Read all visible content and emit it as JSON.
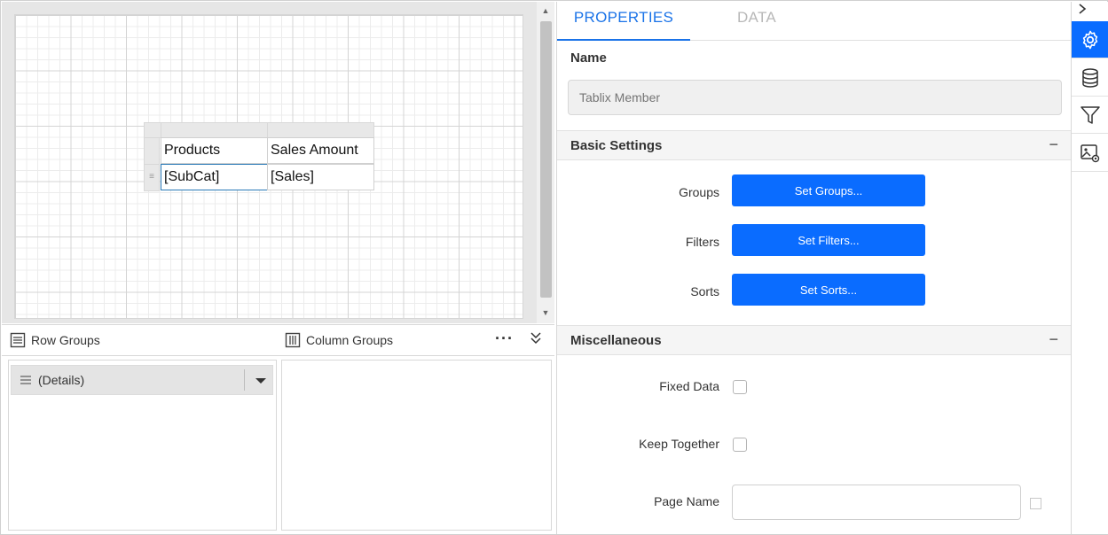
{
  "designer": {
    "tablix": {
      "header_row": [
        "Products",
        "Sales Amount"
      ],
      "detail_row": [
        "[SubCat]",
        "[Sales]"
      ]
    }
  },
  "groups": {
    "row_groups_title": "Row Groups",
    "column_groups_title": "Column Groups",
    "more_label": "···",
    "row_group_items": [
      {
        "label": "(Details)"
      }
    ]
  },
  "properties": {
    "tabs": [
      {
        "label": "PROPERTIES",
        "active": true
      },
      {
        "label": "DATA",
        "active": false
      }
    ],
    "name_label": "Name",
    "name_placeholder": "Tablix Member",
    "basic_settings": {
      "title": "Basic Settings",
      "collapse_symbol": "−",
      "rows": [
        {
          "label": "Groups",
          "button": "Set Groups..."
        },
        {
          "label": "Filters",
          "button": "Set Filters..."
        },
        {
          "label": "Sorts",
          "button": "Set Sorts..."
        }
      ]
    },
    "miscellaneous": {
      "title": "Miscellaneous",
      "collapse_symbol": "−",
      "fixed_data_label": "Fixed Data",
      "keep_together_label": "Keep Together",
      "page_name_label": "Page Name",
      "page_name_value": ""
    }
  },
  "rail": {
    "items": [
      "settings-icon",
      "database-icon",
      "filter-icon",
      "image-settings-icon"
    ]
  },
  "colors": {
    "accent": "#0a6cff",
    "tab_active": "#1a73e8"
  }
}
